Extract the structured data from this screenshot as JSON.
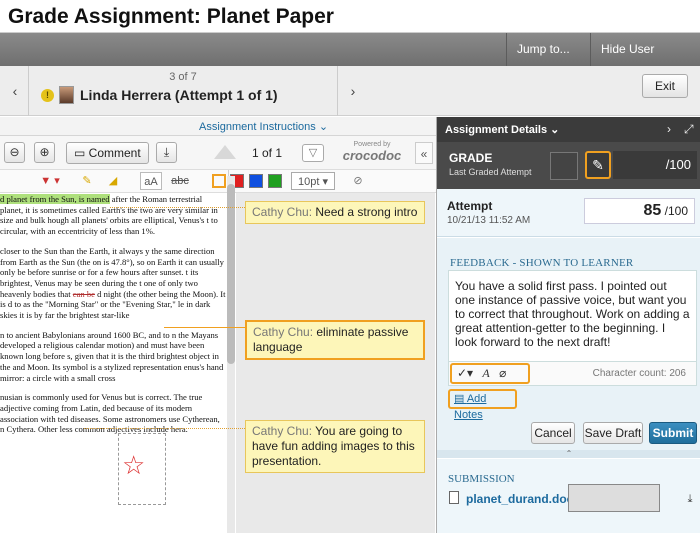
{
  "page_title": "Grade Assignment: Planet Paper",
  "topbar": {
    "jump_label": "Jump to...",
    "hide_label": "Hide User Names"
  },
  "nav": {
    "prev_icon": "chevron-left-icon",
    "next_icon": "chevron-right-icon",
    "count": "3 of 7",
    "student": "Linda Herrera (Attempt 1 of 1)",
    "exit_label": "Exit"
  },
  "instructions": {
    "label": "Assignment Instructions ⌄"
  },
  "viewer": {
    "comment_label": "Comment",
    "page_info": "1 of 1",
    "powered_by": "Powered by",
    "brand": "crocodoc",
    "font_size": "10pt",
    "colors": [
      "#000000",
      "#e02020",
      "#1050e0",
      "#20a020"
    ]
  },
  "document": {
    "paragraphs": [
      {
        "pre": "",
        "highlight": "d planet from the Sun, is named",
        "post": " after the Roman terrestrial planet, it is sometimes called Earth's the two are very similar in size and bulk hough all planets' orbits are elliptical, Venus's t to circular, with an eccentricity of less than 1%."
      },
      {
        "pre": " closer to the Sun than the Earth, it always y the same direction from Earth as the Sun (the on is 47.8°), so on Earth it can usually only be before sunrise or for a few hours after sunset. t its brightest, Venus may be seen during the t one of only two heavenly bodies that ",
        "strike": "can be",
        "post": " d night (the other being the Moon). It is d to as the \"Morning Star\" or the \"Evening Star,\" le in dark skies it is by far the brightest star-like"
      },
      {
        "pre": "n to ancient Babylonians around 1600 BC, and to n the Mayans developed a religious calendar motion) and must have been known long before s, given that it is the third brightest object in the and Moon. Its symbol is a stylized representation enus's hand mirror: a circle with a small cross",
        "post": ""
      },
      {
        "pre": "nusian is commonly used for Venus but is correct. The true adjective coming from Latin, ded because of its modern association with ted diseases. Some astronomers use Cytherean, n Cythera. Other less common adjectives include hera.",
        "post": ""
      }
    ]
  },
  "comments": [
    {
      "author": "Cathy Chu:",
      "text": " Need a strong intro"
    },
    {
      "author": "Cathy Chu:",
      "text": " eliminate passive language"
    },
    {
      "author": "Cathy Chu:",
      "text": " You are going to have fun adding images to this presentation."
    }
  ],
  "panel": {
    "header": "Assignment Details ⌄",
    "grade_title": "GRADE",
    "grade_sub": "Last Graded Attempt",
    "grade_max": "/100",
    "attempt_title": "Attempt",
    "attempt_date": "10/21/13 11:52 AM",
    "attempt_score": "85",
    "attempt_max": "/100",
    "feedback_title": "FEEDBACK - SHOWN TO LEARNER",
    "feedback_text": "You have a solid first pass. I pointed out one instance of passive voice, but want you to correct that throughout. Work on adding a great attention-getter to the beginning. I look forward to the next draft!",
    "char_count": "Character count: 206",
    "add_notes": "Add Notes",
    "cancel": "Cancel",
    "save_draft": "Save Draft",
    "submit": "Submit",
    "submission_title": "SUBMISSION",
    "file_name": "planet_durand.doc"
  }
}
